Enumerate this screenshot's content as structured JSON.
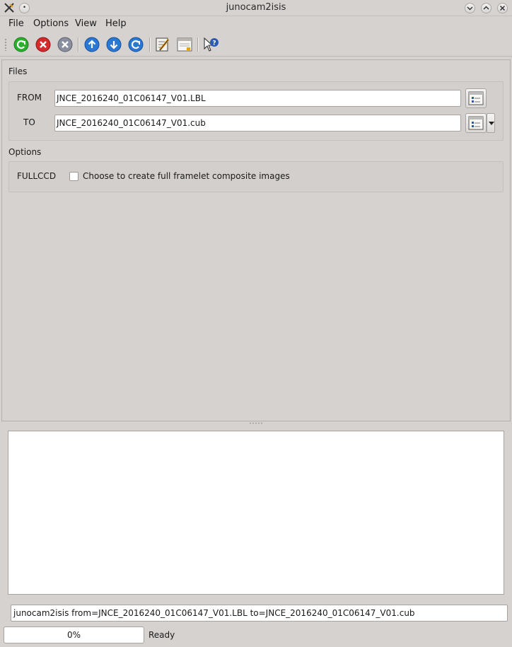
{
  "window": {
    "title": "junocam2isis"
  },
  "menu": [
    {
      "label": "File"
    },
    {
      "label": "Options"
    },
    {
      "label": "View"
    },
    {
      "label": "Help"
    }
  ],
  "toolbar": {
    "buttons": [
      {
        "icon": "run-icon",
        "color": "#2bb02b"
      },
      {
        "icon": "stop-icon",
        "color": "#d42a2a"
      },
      {
        "icon": "exit-icon",
        "color": "#8a8fa0"
      },
      {
        "icon": "history-back-icon",
        "color": "#2a78d4"
      },
      {
        "icon": "history-forward-icon",
        "color": "#2a78d4"
      },
      {
        "icon": "reset-icon",
        "color": "#2a78d4"
      },
      {
        "icon": "edit-parameters-icon"
      },
      {
        "icon": "gui-panel-icon"
      },
      {
        "icon": "whats-this-help-icon"
      }
    ]
  },
  "files": {
    "section_label": "Files",
    "from": {
      "label": "FROM",
      "value": "JNCE_2016240_01C06147_V01.LBL"
    },
    "to": {
      "label": "TO",
      "value": "JNCE_2016240_01C06147_V01.cub"
    }
  },
  "options": {
    "section_label": "Options",
    "fullccd": {
      "label": "FULLCCD",
      "checkbox_text": "Choose to create full framelet composite images",
      "checked": false
    }
  },
  "command_line": "junocam2isis from=JNCE_2016240_01C06147_V01.LBL to=JNCE_2016240_01C06147_V01.cub",
  "progress": {
    "value": "0%"
  },
  "status": "Ready"
}
